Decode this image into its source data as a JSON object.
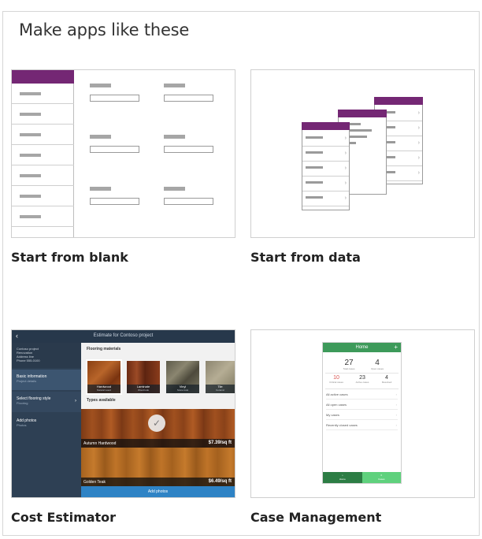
{
  "heading": "Make apps like these",
  "colors": {
    "purple_header": "#742774",
    "border": "#d6d6d6",
    "ce_navy": "#2e4054",
    "ce_blue": "#2e83c5",
    "cm_green": "#3d9a5a",
    "cm_light_green": "#5fd17d"
  },
  "tiles": [
    {
      "label": "Start from blank"
    },
    {
      "label": "Start from data"
    },
    {
      "label": "Cost Estimator",
      "preview": {
        "title": "Estimate for Contoso project",
        "back_icon": "chevron-left-icon",
        "project_lines": [
          "Contoso project",
          "Renovation",
          "Address line",
          "Phone 555-0100"
        ],
        "nav": [
          {
            "main": "Basic information",
            "sub": "Project details"
          },
          {
            "main": "Select flooring style",
            "sub": "Flooring"
          },
          {
            "main": "Add photos",
            "sub": "Photos"
          }
        ],
        "flooring_section": "Flooring materials",
        "flooring": [
          {
            "name": "Hardwood",
            "sub": "Natural wood"
          },
          {
            "name": "Laminate",
            "sub": "Wood look"
          },
          {
            "name": "Vinyl",
            "sub": "Stone look"
          },
          {
            "name": "Tile",
            "sub": "Ceramic"
          }
        ],
        "types_section": "Types available",
        "types": [
          {
            "name": "Autumn Hardwood",
            "price": "$7.39/sq ft"
          },
          {
            "name": "Golden Teak",
            "price": "$6.49/sq ft"
          }
        ],
        "add_button": "Add photos"
      }
    },
    {
      "label": "Case Management",
      "preview": {
        "title": "Home",
        "stats_top": [
          {
            "num": "27",
            "lbl": "Total cases"
          },
          {
            "num": "4",
            "lbl": "Open cases"
          }
        ],
        "stats_bottom": [
          {
            "num": "10",
            "lbl": "Critical cases"
          },
          {
            "num": "23",
            "lbl": "Active cases"
          },
          {
            "num": "4",
            "lbl": "Resolved"
          }
        ],
        "links": [
          "All active cases",
          "All open cases",
          "My cases",
          "Recently closed cases"
        ],
        "bottom_left": "Home",
        "bottom_right": "Cases"
      }
    }
  ]
}
